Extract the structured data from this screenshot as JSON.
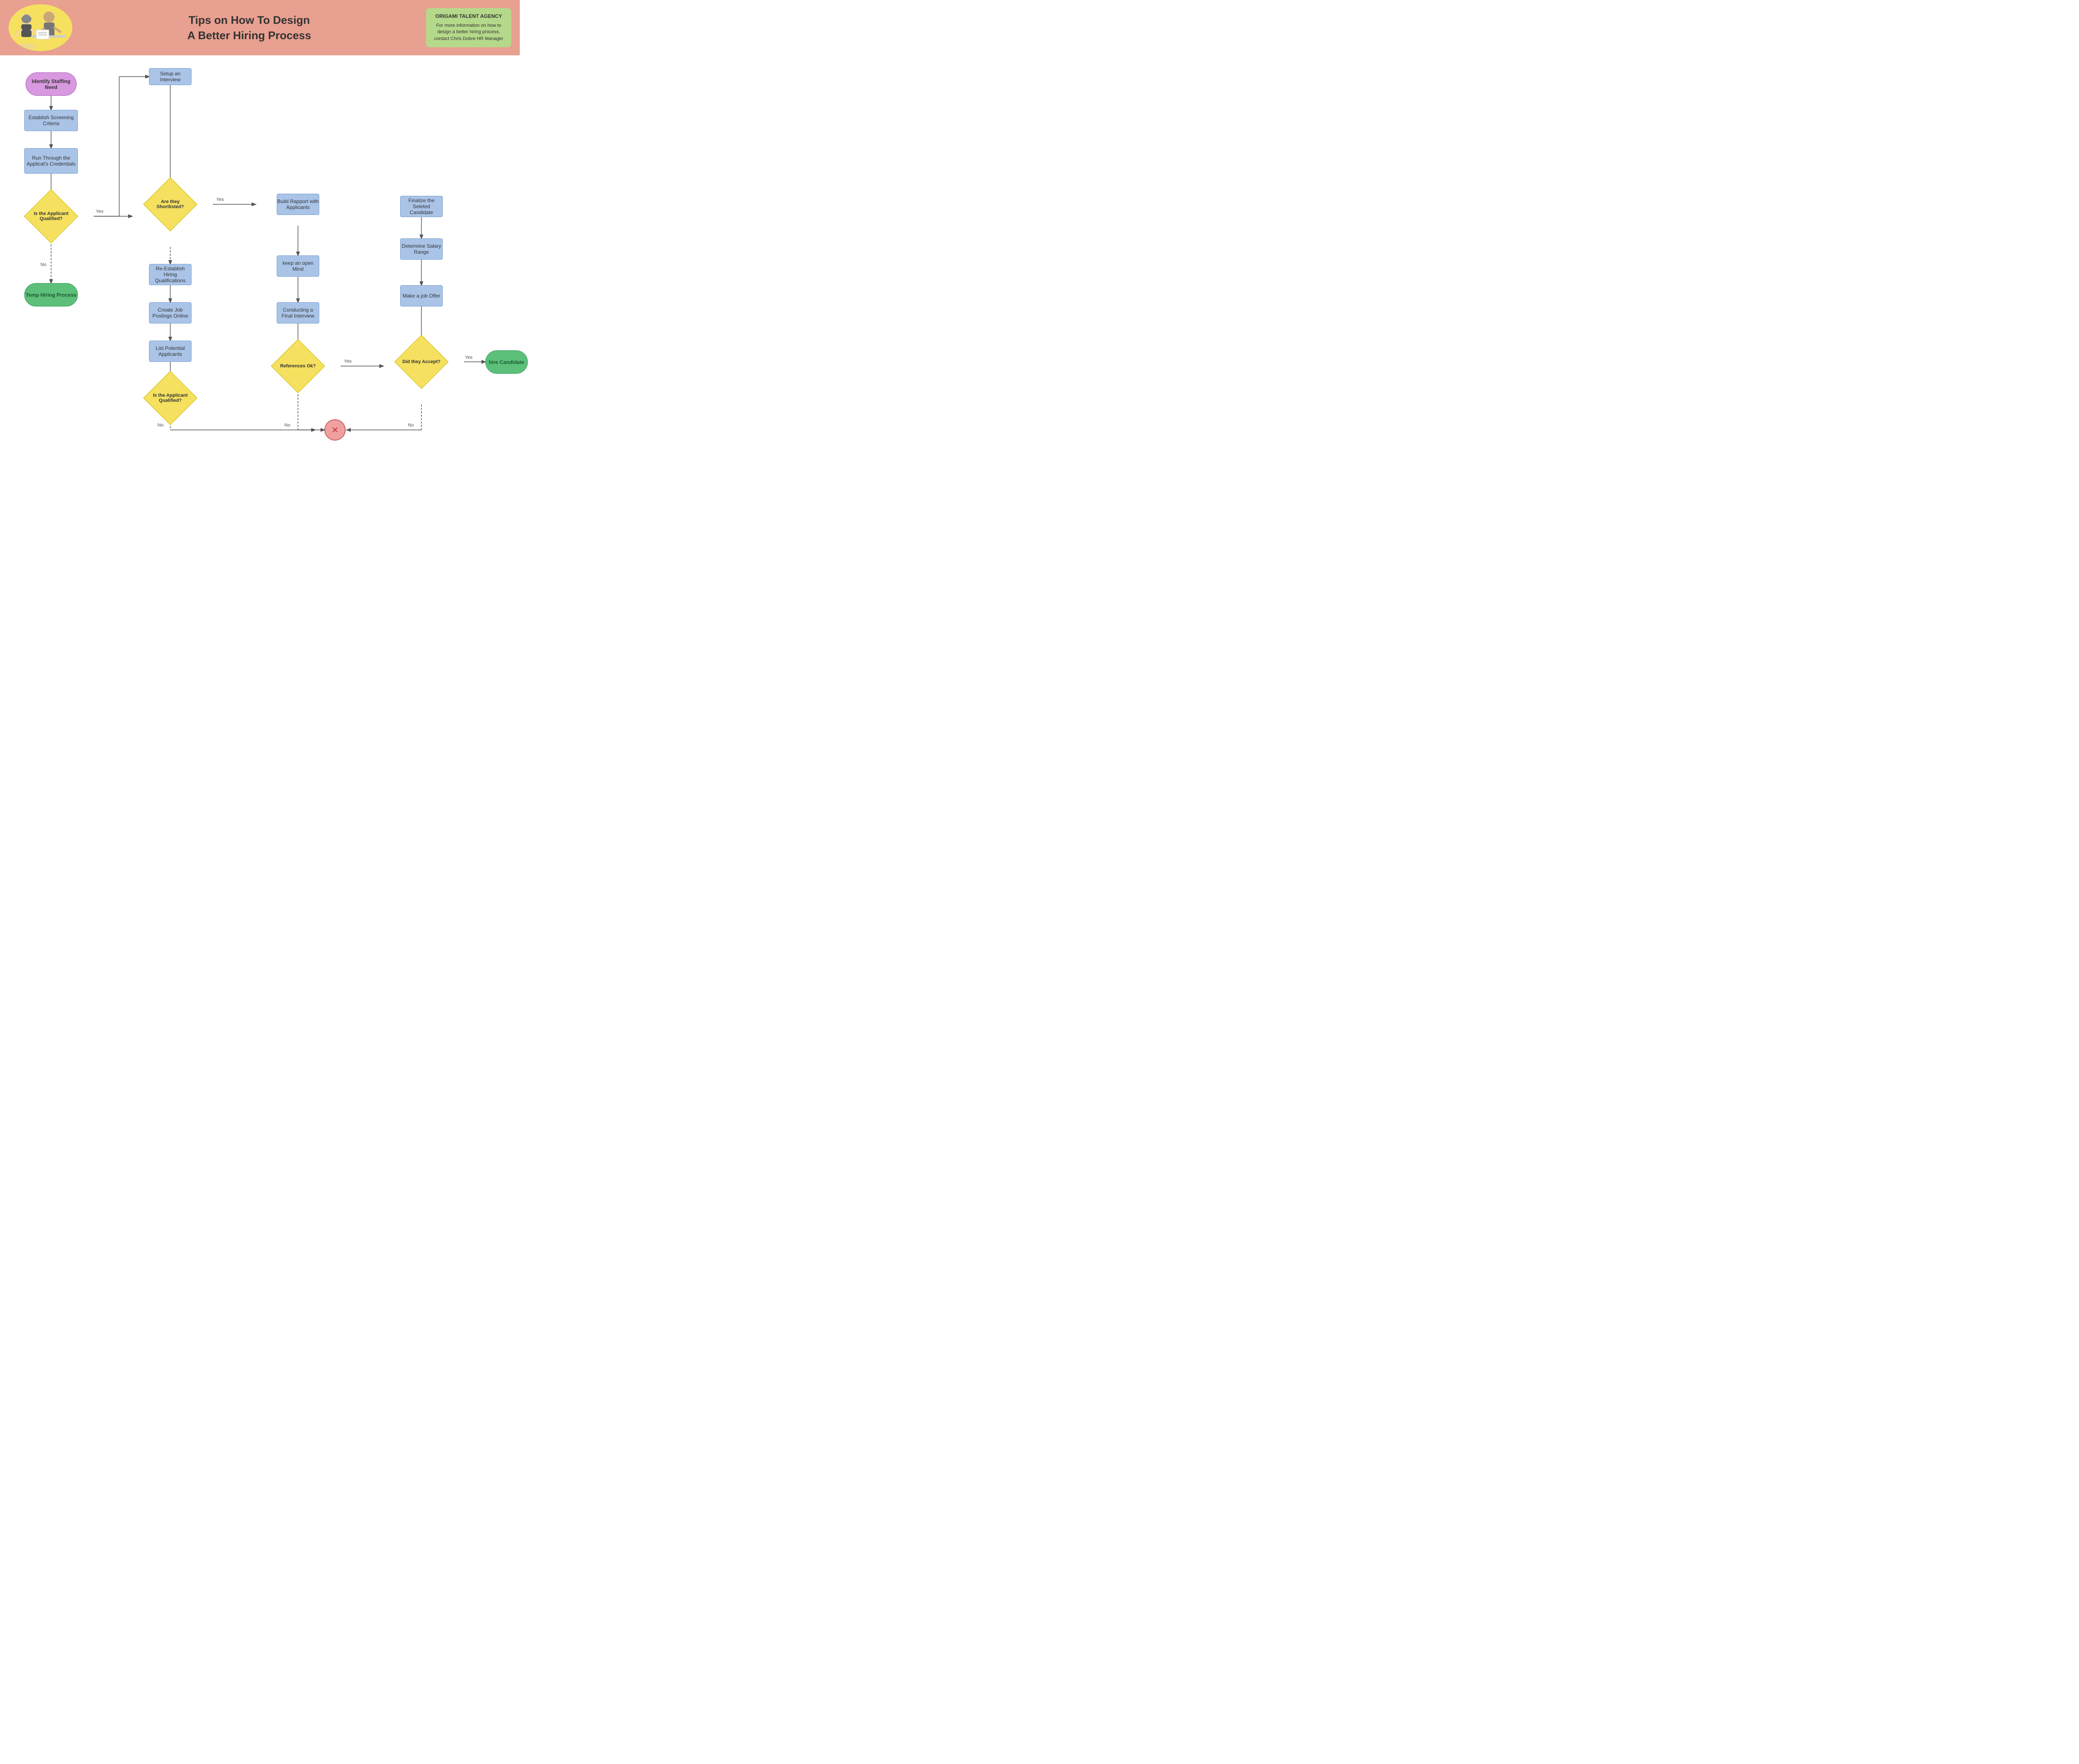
{
  "header": {
    "title_line1": "Tips on How To Design",
    "title_line2": "A Better Hiring Process",
    "agency_name": "ORIGAMI TALENT AGENCY",
    "agency_desc": "For more information on how to design a better hiring process, contact Chris Dobre HR Manager"
  },
  "flowchart": {
    "nodes": [
      {
        "id": "identify",
        "label": "Identify Staffing Need",
        "type": "oval"
      },
      {
        "id": "screening",
        "label": "Establish Screening Criteria",
        "type": "rect"
      },
      {
        "id": "credentials",
        "label": "Run Through the Applicat's Credentials",
        "type": "rect"
      },
      {
        "id": "qualified1",
        "label": "Is the Applicant Qualified?",
        "type": "diamond"
      },
      {
        "id": "temp",
        "label": "Temp Hiring Process",
        "type": "oval-green"
      },
      {
        "id": "setup_interview",
        "label": "Setup an Interview",
        "type": "rect"
      },
      {
        "id": "shortlisted",
        "label": "Are they Shortlisted?",
        "type": "diamond"
      },
      {
        "id": "re_establish",
        "label": "Re-Establish Hiring Qualifications",
        "type": "rect"
      },
      {
        "id": "create_postings",
        "label": "Create Job Postings Online",
        "type": "rect"
      },
      {
        "id": "list_applicants",
        "label": "List Potential Applicants",
        "type": "rect"
      },
      {
        "id": "qualified2",
        "label": "Is the Applicant Qualified?",
        "type": "diamond"
      },
      {
        "id": "build_rapport",
        "label": "Build Rapport with Applicants",
        "type": "rect"
      },
      {
        "id": "open_mind",
        "label": "keep an open Mind",
        "type": "rect"
      },
      {
        "id": "final_interview",
        "label": "Conducting a Final Interview",
        "type": "rect"
      },
      {
        "id": "references",
        "label": "References Ok?",
        "type": "diamond"
      },
      {
        "id": "finalize",
        "label": "Finalize the Seleted Candidate",
        "type": "rect"
      },
      {
        "id": "salary",
        "label": "Determine Salary Range",
        "type": "rect"
      },
      {
        "id": "job_offer",
        "label": "Make a job Offer",
        "type": "rect"
      },
      {
        "id": "did_accept",
        "label": "Did they Accept?",
        "type": "diamond"
      },
      {
        "id": "hire",
        "label": "hire Candidate",
        "type": "oval-green"
      },
      {
        "id": "circle_x",
        "label": "✕",
        "type": "circle-x"
      }
    ]
  }
}
